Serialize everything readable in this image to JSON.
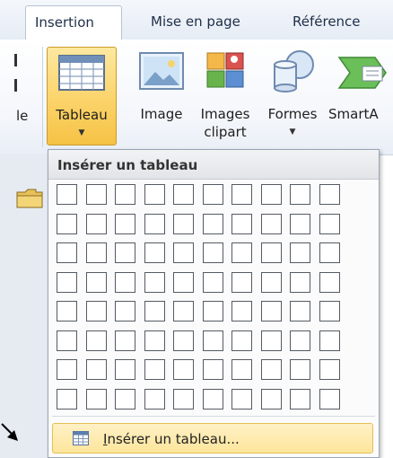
{
  "tabs": [
    {
      "label": "Insertion",
      "active": true
    },
    {
      "label": "Mise en page",
      "active": false
    },
    {
      "label": "Référence",
      "active": false
    }
  ],
  "ribbon": {
    "partial_left_label": "le",
    "buttons": {
      "tableau": "Tableau",
      "image": "Image",
      "images_line1": "Images",
      "images_line2": "clipart",
      "formes": "Formes",
      "smartart": "SmartA"
    }
  },
  "dropdown": {
    "header": "Insérer un tableau",
    "grid": {
      "rows": 8,
      "columns": 10
    },
    "menu_item": "Insérer un tableau...",
    "menu_item_access_key": "I"
  },
  "colors": {
    "accent_pressed": "#fbd36a",
    "menu_highlight": "#fde59b",
    "ribbon_bg": "#f3f6fb"
  },
  "icons": [
    "table-icon",
    "picture-icon",
    "clipart-icon",
    "shapes-icon",
    "smartart-icon",
    "folder-icon",
    "pointer-arrow-icon",
    "table-small-icon"
  ]
}
